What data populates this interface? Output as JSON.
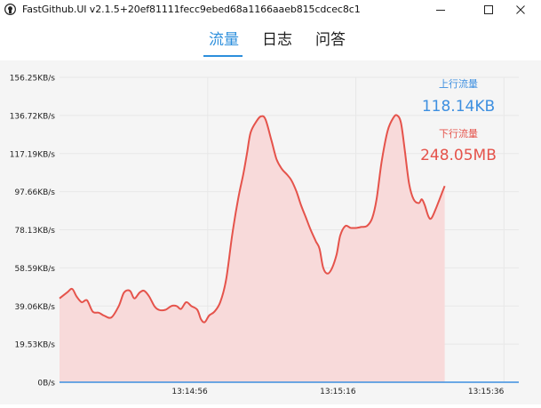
{
  "window": {
    "title": "FastGithub.UI v2.1.5+20ef81111fecc9ebed68a1166aaeb815cdcec8c1"
  },
  "tabs": [
    {
      "label": "流量",
      "active": true
    },
    {
      "label": "日志",
      "active": false
    },
    {
      "label": "问答",
      "active": false
    }
  ],
  "colors": {
    "accent": "#2d8fdc",
    "upload": "#3d8fe0",
    "download": "#e5534b",
    "download_fill": "#f8dada"
  },
  "chart_data": {
    "type": "area",
    "y_tick_labels": [
      "0B/s",
      "19.53KB/s",
      "39.06KB/s",
      "58.59KB/s",
      "78.13KB/s",
      "97.66KB/s",
      "117.19KB/s",
      "136.72KB/s",
      "156.25KB/s"
    ],
    "ylim": [
      0,
      160000
    ],
    "x_ticks": [
      {
        "t": 20,
        "label": "13:14:56"
      },
      {
        "t": 40,
        "label": "13:15:16"
      },
      {
        "t": 60,
        "label": "13:15:36"
      }
    ],
    "xlim": [
      0,
      62
    ],
    "grid": true,
    "series": [
      {
        "name": "上行流量",
        "total": "118.14KB",
        "color": "#3d8fe0",
        "points": [
          [
            0,
            0
          ],
          [
            62,
            0
          ]
        ]
      },
      {
        "name": "下行流量",
        "total": "248.05MB",
        "color": "#e5534b",
        "points": [
          [
            0,
            44000
          ],
          [
            1,
            47000
          ],
          [
            1.7,
            49000
          ],
          [
            2.3,
            45000
          ],
          [
            3,
            42000
          ],
          [
            3.7,
            43000
          ],
          [
            4.5,
            37000
          ],
          [
            5.3,
            36500
          ],
          [
            6,
            35000
          ],
          [
            7,
            34000
          ],
          [
            8,
            40000
          ],
          [
            8.7,
            47000
          ],
          [
            9.5,
            48000
          ],
          [
            10.1,
            44000
          ],
          [
            10.8,
            47000
          ],
          [
            11.4,
            48000
          ],
          [
            12.1,
            45000
          ],
          [
            12.8,
            40000
          ],
          [
            13.4,
            38000
          ],
          [
            14.3,
            38000
          ],
          [
            15.1,
            40000
          ],
          [
            15.8,
            40000
          ],
          [
            16.4,
            38500
          ],
          [
            17.1,
            42000
          ],
          [
            17.8,
            40000
          ],
          [
            18.6,
            38000
          ],
          [
            19.1,
            33000
          ],
          [
            19.6,
            31500
          ],
          [
            20.2,
            35000
          ],
          [
            20.9,
            37000
          ],
          [
            21.7,
            42000
          ],
          [
            22.5,
            54000
          ],
          [
            23.3,
            77000
          ],
          [
            24.1,
            96000
          ],
          [
            24.8,
            109000
          ],
          [
            25.3,
            120000
          ],
          [
            25.8,
            131000
          ],
          [
            26.6,
            137000
          ],
          [
            27.2,
            139500
          ],
          [
            27.8,
            138000
          ],
          [
            28.6,
            127000
          ],
          [
            29.3,
            117000
          ],
          [
            30.0,
            112000
          ],
          [
            30.7,
            109000
          ],
          [
            31.3,
            106000
          ],
          [
            32.0,
            100000
          ],
          [
            32.6,
            93000
          ],
          [
            33.3,
            86000
          ],
          [
            33.9,
            80000
          ],
          [
            34.6,
            74000
          ],
          [
            35.1,
            70000
          ],
          [
            35.6,
            60000
          ],
          [
            36.2,
            57000
          ],
          [
            36.8,
            60000
          ],
          [
            37.4,
            67000
          ],
          [
            37.9,
            77000
          ],
          [
            38.6,
            82000
          ],
          [
            39.3,
            81000
          ],
          [
            40.1,
            81000
          ],
          [
            40.8,
            81500
          ],
          [
            41.5,
            82000
          ],
          [
            42.2,
            86000
          ],
          [
            42.8,
            96000
          ],
          [
            43.5,
            116000
          ],
          [
            44.3,
            132000
          ],
          [
            45.1,
            139000
          ],
          [
            45.6,
            140000
          ],
          [
            46.1,
            136000
          ],
          [
            46.6,
            122000
          ],
          [
            47.2,
            104000
          ],
          [
            47.8,
            96000
          ],
          [
            48.5,
            94000
          ],
          [
            48.9,
            96000
          ],
          [
            49.3,
            93000
          ],
          [
            49.8,
            87000
          ],
          [
            50.2,
            86000
          ],
          [
            50.8,
            91000
          ],
          [
            51.3,
            96000
          ],
          [
            52.0,
            103000
          ]
        ]
      }
    ]
  }
}
